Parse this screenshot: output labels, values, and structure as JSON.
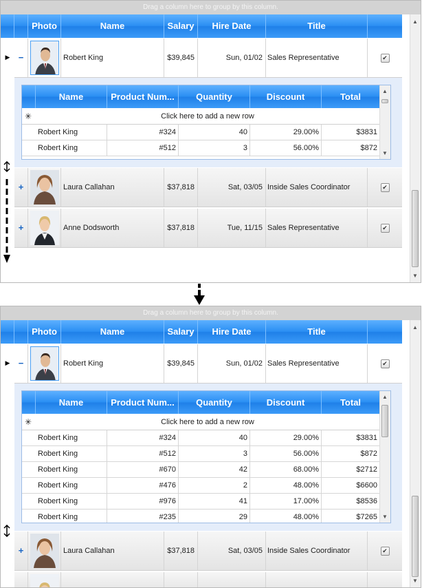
{
  "group_panel_text": "Drag a column here to group by this column.",
  "columns": {
    "photo": "Photo",
    "name": "Name",
    "salary": "Salary",
    "hire_date": "Hire Date",
    "title": "Title"
  },
  "employees": [
    {
      "name": "Robert King",
      "salary": "$39,845",
      "hire_date": "Sun, 01/02",
      "title": "Sales Representative",
      "checked": "✔",
      "expand": "−"
    },
    {
      "name": "Laura Callahan",
      "salary": "$37,818",
      "hire_date": "Sat, 03/05",
      "title": "Inside Sales Coordinator",
      "checked": "✔",
      "expand": "+"
    },
    {
      "name": "Anne Dodsworth",
      "salary": "$37,818",
      "hire_date": "Tue, 11/15",
      "title": "Sales Representative",
      "checked": "✔",
      "expand": "+"
    }
  ],
  "detail_columns": {
    "name": "Name",
    "product_number": "Product Num...",
    "quantity": "Quantity",
    "discount": "Discount",
    "total": "Total"
  },
  "add_row_text": "Click here to add a new row",
  "add_row_marker": "✳",
  "orders": [
    {
      "name": "Robert King",
      "product_number": "#324",
      "quantity": "40",
      "discount": "29.00%",
      "total": "$3831"
    },
    {
      "name": "Robert King",
      "product_number": "#512",
      "quantity": "3",
      "discount": "56.00%",
      "total": "$872"
    },
    {
      "name": "Robert King",
      "product_number": "#670",
      "quantity": "42",
      "discount": "68.00%",
      "total": "$2712"
    },
    {
      "name": "Robert King",
      "product_number": "#476",
      "quantity": "2",
      "discount": "48.00%",
      "total": "$6600"
    },
    {
      "name": "Robert King",
      "product_number": "#976",
      "quantity": "41",
      "discount": "17.00%",
      "total": "$8536"
    },
    {
      "name": "Robert King",
      "product_number": "#235",
      "quantity": "29",
      "discount": "48.00%",
      "total": "$7265"
    }
  ],
  "icons": {
    "row_indicator": "current-row-arrow-icon",
    "resize": "resize-vertical-icon",
    "down_arrow": "down-arrow-icon"
  },
  "colors": {
    "header_blue": "#2b8ff3",
    "detail_background": "#e4edfa"
  }
}
